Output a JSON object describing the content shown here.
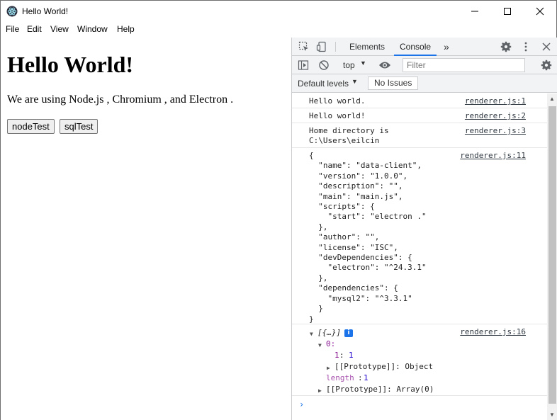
{
  "window": {
    "title": "Hello World!"
  },
  "menubar": {
    "items": [
      "File",
      "Edit",
      "View",
      "Window",
      "Help"
    ]
  },
  "page": {
    "heading": "Hello World!",
    "paragraph": "We are using Node.js , Chromium , and Electron .",
    "buttons": [
      "nodeTest",
      "sqlTest"
    ]
  },
  "devtools": {
    "tabs": [
      "Elements",
      "Console"
    ],
    "active_tab": "Console",
    "context": "top",
    "filter_placeholder": "Filter",
    "levels_label": "Default levels",
    "issues_label": "No Issues",
    "accent_color": "#1a73e8",
    "console_messages": [
      {
        "text": "Hello world.",
        "source": "renderer.js:1"
      },
      {
        "text": "Hello world!",
        "source": "renderer.js:2"
      },
      {
        "text": "Home directory is\nC:\\Users\\eilcin",
        "source": "renderer.js:3"
      },
      {
        "text": "{\n  \"name\": \"data-client\",\n  \"version\": \"1.0.0\",\n  \"description\": \"\",\n  \"main\": \"main.js\",\n  \"scripts\": {\n    \"start\": \"electron .\"\n  },\n  \"author\": \"\",\n  \"license\": \"ISC\",\n  \"devDependencies\": {\n    \"electron\": \"^24.3.1\"\n  },\n  \"dependencies\": {\n    \"mysql2\": \"^3.3.1\"\n  }\n}",
        "source": "renderer.js:11"
      }
    ],
    "array_log": {
      "source": "renderer.js:16",
      "summary": "[{…}]",
      "index_key": "0:",
      "entry_key": "1",
      "entry_value": "1",
      "proto_object": "[[Prototype]]: Object",
      "length_key": "length",
      "length_value": "1",
      "proto_array": "[[Prototype]]: Array(0)"
    }
  }
}
